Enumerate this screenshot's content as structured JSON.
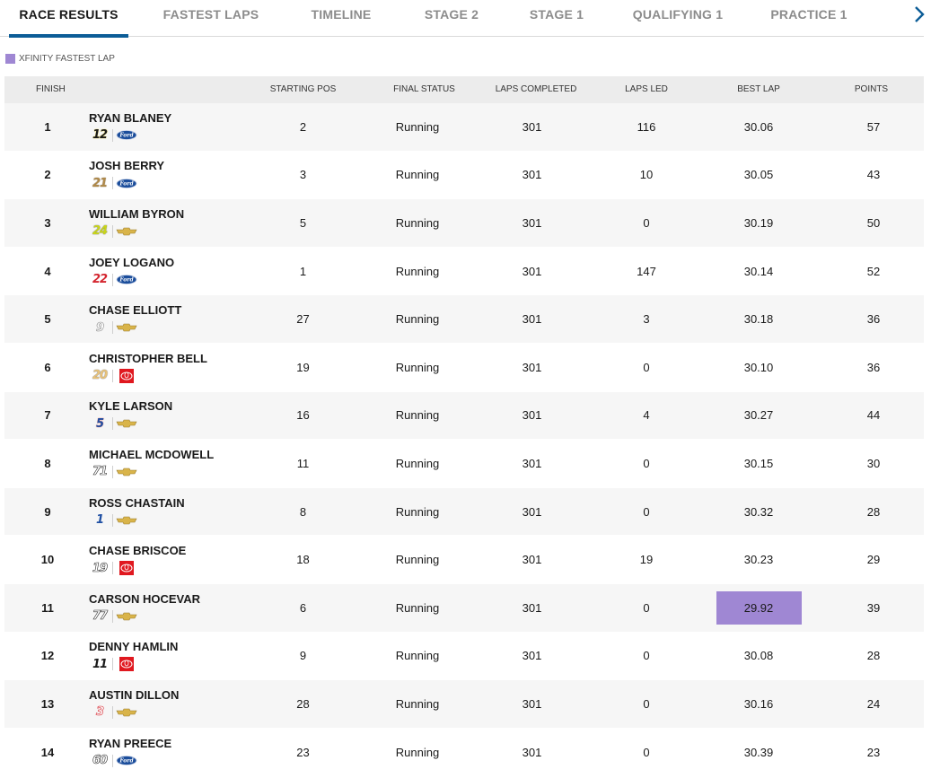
{
  "tabs": [
    {
      "label": "RACE RESULTS",
      "active": true
    },
    {
      "label": "FASTEST LAPS",
      "active": false
    },
    {
      "label": "TIMELINE",
      "active": false
    },
    {
      "label": "STAGE 2",
      "active": false
    },
    {
      "label": "STAGE 1",
      "active": false
    },
    {
      "label": "QUALIFYING 1",
      "active": false
    },
    {
      "label": "PRACTICE 1",
      "active": false
    }
  ],
  "next_icon": "chevron-right-icon",
  "legend": {
    "label": "XFINITY FASTEST LAP",
    "color": "#9f87d3"
  },
  "columns": {
    "finish": "FINISH",
    "starting_pos": "STARTING POS",
    "final_status": "FINAL STATUS",
    "laps_completed": "LAPS COMPLETED",
    "laps_led": "LAPS LED",
    "best_lap": "BEST LAP",
    "points": "POINTS"
  },
  "colors": {
    "accent": "#0c5d97",
    "fastest": "#9f87d3",
    "header_bg": "#ececec",
    "row_alt_bg": "#f6f6f6"
  },
  "rows": [
    {
      "finish": "1",
      "driver": "RYAN BLANEY",
      "car_number": "12",
      "car_color": "#1a1a1a",
      "car_accent": "#f2d300",
      "manufacturer": "ford",
      "starting_pos": "2",
      "status": "Running",
      "laps": "301",
      "led": "116",
      "best_lap": "30.06",
      "points": "57",
      "fastest": false
    },
    {
      "finish": "2",
      "driver": "JOSH BERRY",
      "car_number": "21",
      "car_color": "#b08a4a",
      "car_accent": "#5a4424",
      "manufacturer": "ford",
      "starting_pos": "3",
      "status": "Running",
      "laps": "301",
      "led": "10",
      "best_lap": "30.05",
      "points": "43",
      "fastest": false
    },
    {
      "finish": "3",
      "driver": "WILLIAM BYRON",
      "car_number": "24",
      "car_color": "#c9d61a",
      "car_accent": "#2a2a2a",
      "manufacturer": "chevrolet",
      "starting_pos": "5",
      "status": "Running",
      "laps": "301",
      "led": "0",
      "best_lap": "30.19",
      "points": "50",
      "fastest": false
    },
    {
      "finish": "4",
      "driver": "JOEY LOGANO",
      "car_number": "22",
      "car_color": "#d4262f",
      "car_accent": "#ffffff",
      "manufacturer": "ford",
      "starting_pos": "1",
      "status": "Running",
      "laps": "301",
      "led": "147",
      "best_lap": "30.14",
      "points": "52",
      "fastest": false
    },
    {
      "finish": "5",
      "driver": "CHASE ELLIOTT",
      "car_number": "9",
      "car_color": "#ffffff",
      "car_accent": "#8a8a8a",
      "manufacturer": "chevrolet",
      "starting_pos": "27",
      "status": "Running",
      "laps": "301",
      "led": "3",
      "best_lap": "30.18",
      "points": "36",
      "fastest": false
    },
    {
      "finish": "6",
      "driver": "CHRISTOPHER BELL",
      "car_number": "20",
      "car_color": "#e8c27a",
      "car_accent": "#2a2a2a",
      "manufacturer": "toyota",
      "starting_pos": "19",
      "status": "Running",
      "laps": "301",
      "led": "0",
      "best_lap": "30.10",
      "points": "36",
      "fastest": false
    },
    {
      "finish": "7",
      "driver": "KYLE LARSON",
      "car_number": "5",
      "car_color": "#1f4fa3",
      "car_accent": "#e23b2b",
      "manufacturer": "chevrolet",
      "starting_pos": "16",
      "status": "Running",
      "laps": "301",
      "led": "4",
      "best_lap": "30.27",
      "points": "44",
      "fastest": false
    },
    {
      "finish": "8",
      "driver": "MICHAEL MCDOWELL",
      "car_number": "71",
      "car_color": "#ffffff",
      "car_accent": "#2a2a2a",
      "manufacturer": "chevrolet",
      "starting_pos": "11",
      "status": "Running",
      "laps": "301",
      "led": "0",
      "best_lap": "30.15",
      "points": "30",
      "fastest": false
    },
    {
      "finish": "9",
      "driver": "ROSS CHASTAIN",
      "car_number": "1",
      "car_color": "#1f4fa3",
      "car_accent": "#ffffff",
      "manufacturer": "chevrolet",
      "starting_pos": "8",
      "status": "Running",
      "laps": "301",
      "led": "0",
      "best_lap": "30.32",
      "points": "28",
      "fastest": false
    },
    {
      "finish": "10",
      "driver": "CHASE BRISCOE",
      "car_number": "19",
      "car_color": "#ffffff",
      "car_accent": "#2a2a2a",
      "manufacturer": "toyota",
      "starting_pos": "18",
      "status": "Running",
      "laps": "301",
      "led": "19",
      "best_lap": "30.23",
      "points": "29",
      "fastest": false
    },
    {
      "finish": "11",
      "driver": "CARSON HOCEVAR",
      "car_number": "77",
      "car_color": "#ffffff",
      "car_accent": "#2a2a2a",
      "manufacturer": "chevrolet",
      "starting_pos": "6",
      "status": "Running",
      "laps": "301",
      "led": "0",
      "best_lap": "29.92",
      "points": "39",
      "fastest": true
    },
    {
      "finish": "12",
      "driver": "DENNY HAMLIN",
      "car_number": "11",
      "car_color": "#1a1a1a",
      "car_accent": "#ffffff",
      "manufacturer": "toyota",
      "starting_pos": "9",
      "status": "Running",
      "laps": "301",
      "led": "0",
      "best_lap": "30.08",
      "points": "28",
      "fastest": false
    },
    {
      "finish": "13",
      "driver": "AUSTIN DILLON",
      "car_number": "3",
      "car_color": "#ffffff",
      "car_accent": "#d4262f",
      "manufacturer": "chevrolet",
      "starting_pos": "28",
      "status": "Running",
      "laps": "301",
      "led": "0",
      "best_lap": "30.16",
      "points": "24",
      "fastest": false
    },
    {
      "finish": "14",
      "driver": "RYAN PREECE",
      "car_number": "60",
      "car_color": "#ffffff",
      "car_accent": "#2a2a2a",
      "manufacturer": "ford",
      "starting_pos": "23",
      "status": "Running",
      "laps": "301",
      "led": "0",
      "best_lap": "30.39",
      "points": "23",
      "fastest": false
    }
  ]
}
